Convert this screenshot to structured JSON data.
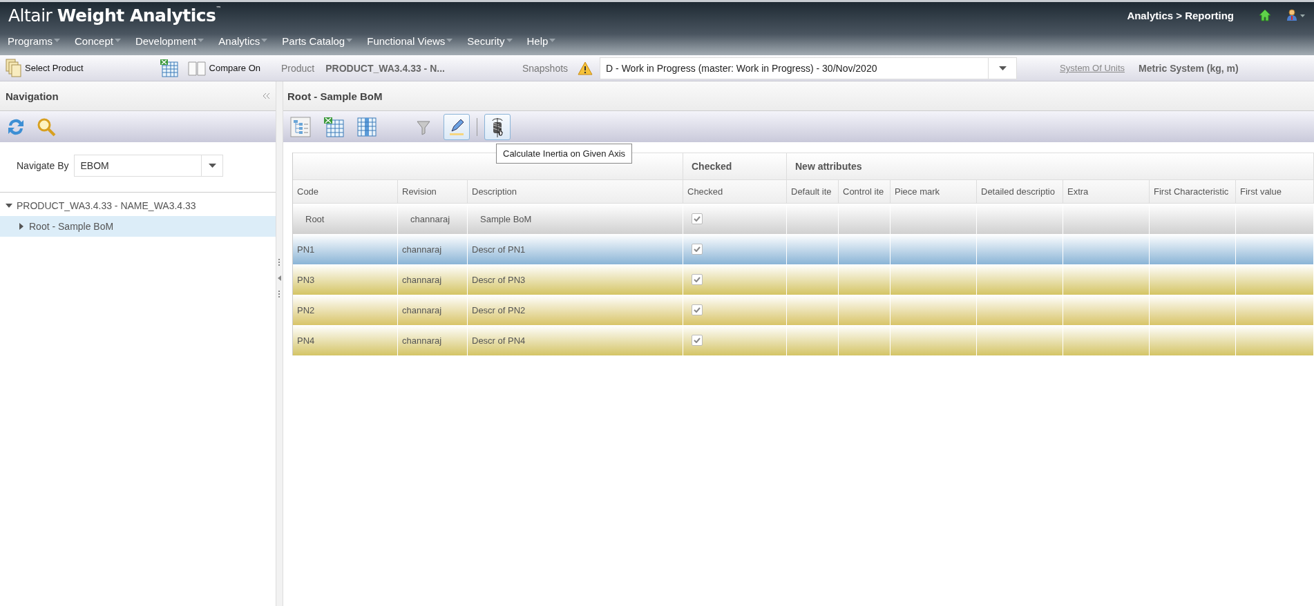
{
  "header": {
    "brand_light": "Altair",
    "brand_bold": "Weight Analytics",
    "trademark": "™",
    "breadcrumb": "Analytics > Reporting",
    "menu": [
      {
        "label": "Programs"
      },
      {
        "label": "Concept"
      },
      {
        "label": "Development"
      },
      {
        "label": "Analytics"
      },
      {
        "label": "Parts Catalog"
      },
      {
        "label": "Functional Views"
      },
      {
        "label": "Security"
      },
      {
        "label": "Help"
      }
    ]
  },
  "toolbar": {
    "select_product": "Select Product",
    "compare": "Compare On",
    "product_label": "Product",
    "product_value": "PRODUCT_WA3.4.33 - N...",
    "snapshots_label": "Snapshots",
    "snapshot_value": "D - Work in Progress (master: Work in Progress) - 30/Nov/2020",
    "units_link": "System Of Units",
    "units_value": "Metric System (kg, m)"
  },
  "navigation": {
    "title": "Navigation",
    "navigate_by_label": "Navigate By",
    "navigate_by_value": "EBOM",
    "tree": [
      {
        "label": "PRODUCT_WA3.4.33 - NAME_WA3.4.33",
        "expanded": true,
        "selected": false,
        "children": [
          {
            "label": "Root - Sample BoM",
            "expanded": false,
            "selected": true
          }
        ]
      }
    ]
  },
  "bom": {
    "title": "Root - Sample BoM",
    "tools": [
      {
        "active": false
      },
      {
        "active": false
      },
      {
        "active": false
      },
      {
        "active": false
      },
      {
        "active": true
      },
      {
        "active": true
      }
    ],
    "tooltip": "Calculate Inertia on Given Axis",
    "groups": [
      {
        "label": "Checked"
      },
      {
        "label": "New attributes"
      }
    ],
    "columns": [
      "Code",
      "Revision",
      "Description",
      "Checked",
      "Default ite",
      "Control ite",
      "Piece mark",
      "Detailed descriptio",
      "Extra",
      "First Characteristic",
      "First value"
    ],
    "rows": [
      {
        "code": "Root",
        "revision": "channaraj",
        "description": "Sample BoM",
        "checked": true,
        "color": "#d0d0d0"
      },
      {
        "code": "PN1",
        "revision": "channaraj",
        "description": "Descr of PN1",
        "checked": true,
        "color": "#8ab4d6"
      },
      {
        "code": "PN3",
        "revision": "channaraj",
        "description": "Descr of PN3",
        "checked": true,
        "color": "#d4c464"
      },
      {
        "code": "PN2",
        "revision": "channaraj",
        "description": "Descr of PN2",
        "checked": true,
        "color": "#d8c468"
      },
      {
        "code": "PN4",
        "revision": "channaraj",
        "description": "Descr of PN4",
        "checked": true,
        "color": "#d4c466"
      }
    ]
  }
}
